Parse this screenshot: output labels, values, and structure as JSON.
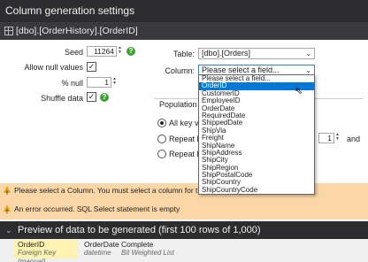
{
  "window": {
    "title": "Column generation settings"
  },
  "column_path": "[dbo].[OrderHistory].[OrderID]",
  "settings": {
    "seed_label": "Seed",
    "seed_value": "11264",
    "allow_null_label": "Allow null values",
    "allow_null_checked": "✓",
    "pct_null_label": "% null",
    "pct_null_value": "1",
    "shuffle_label": "Shuffle data",
    "shuffle_checked": "✓",
    "help_glyph": "?"
  },
  "foreign_key": {
    "table_label": "Table:",
    "table_value": "[dbo].[Orders]",
    "column_label": "Column:",
    "column_value": "Please select a field...",
    "population_label": "Population me",
    "opt_all": "All key valu",
    "opt_repeat1": "Repeat key",
    "opt_repeat2": "Repeat key",
    "spinner_value": "1",
    "and_label": "and"
  },
  "dropdown_items": [
    "Please select a field...",
    "OrderID",
    "CustomerID",
    "EmployeeID",
    "OrderDate",
    "RequiredDate",
    "ShippedDate",
    "ShipVia",
    "Freight",
    "ShipName",
    "ShipAddress",
    "ShipCity",
    "ShipRegion",
    "ShipPostalCode",
    "ShipCountry",
    "ShipCountryCode"
  ],
  "selected_item": "OrderID",
  "warnings": [
    "Please select a Column. You must select a column for the Foreign Key",
    "An error occurred. SQL Select statement is empty"
  ],
  "preview": {
    "title": "Preview of data to be generated (first 100 rows of 1,000)",
    "columns": [
      {
        "name": "OrderID",
        "type": "Foreign Key (manual)"
      },
      {
        "name": "OrderDate",
        "type": "datetime"
      },
      {
        "name": "Complete",
        "type": "Bit Weighted List"
      }
    ]
  },
  "colors": {
    "accent": "#0078d7",
    "warning_bg": "#fbd7a8",
    "help_green": "#41a335",
    "title_bg": "#2d2d30"
  }
}
